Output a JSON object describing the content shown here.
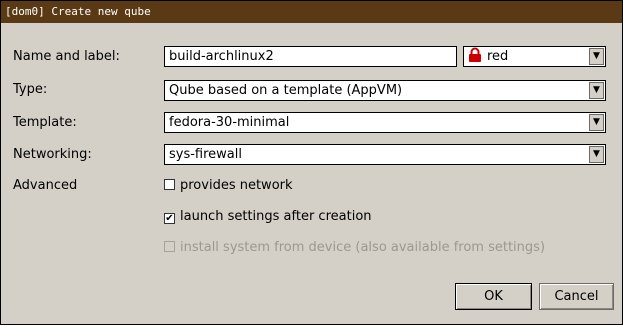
{
  "window": {
    "title": "[dom0] Create new qube"
  },
  "form": {
    "name_label": "Name and label:",
    "name_value": "build-archlinux2",
    "color_value": "red",
    "type_label": "Type:",
    "type_value": "Qube based on a template (AppVM)",
    "template_label": "Template:",
    "template_value": "fedora-30-minimal",
    "networking_label": "Networking:",
    "networking_value": "sys-firewall",
    "advanced_label": "Advanced",
    "provides_network_label": "provides network",
    "provides_network_checked": false,
    "launch_settings_label": "launch settings after creation",
    "launch_settings_checked": true,
    "install_from_device_label": "install system from device (also available from settings)",
    "install_from_device_checked": false,
    "install_from_device_enabled": false
  },
  "buttons": {
    "ok": "OK",
    "cancel": "Cancel"
  },
  "icons": {
    "label_color_icon": "lock-icon",
    "lock_color": "#cc0000"
  }
}
